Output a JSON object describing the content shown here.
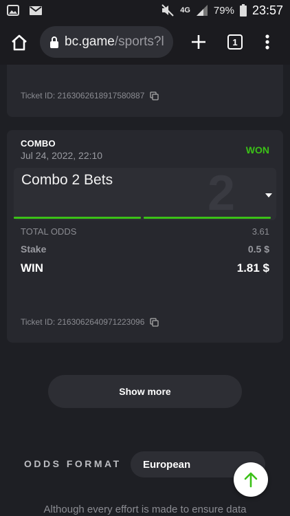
{
  "status_bar": {
    "network": "4G",
    "battery": "79%",
    "time": "23:57",
    "icons": [
      "image-icon",
      "mail-icon",
      "mute-icon",
      "signal-icon",
      "battery-icon"
    ]
  },
  "browser": {
    "url_host": "bc.game",
    "url_path": "/sports?l",
    "tab_count": "1",
    "icons": [
      "home-icon",
      "lock-icon",
      "plus-icon",
      "tabs-icon",
      "more-vert-icon"
    ]
  },
  "previous_ticket": {
    "ticket_id": "Ticket ID: 2163062618917580887"
  },
  "bet": {
    "type": "COMBO",
    "date": "Jul 24, 2022, 22:10",
    "status": "WON",
    "combo_title": "Combo 2 Bets",
    "combo_count": "2",
    "total_odds_label": "TOTAL ODDS",
    "total_odds_value": "3.61",
    "stake_label": "Stake",
    "stake_value": "0.5 $",
    "win_label": "WIN",
    "win_value": "1.81 $",
    "ticket_id": "Ticket ID: 2163062640971223096"
  },
  "show_more_label": "Show more",
  "odds_format": {
    "label": "ODDS FORMAT",
    "value": "European"
  },
  "disclaimer": "Although every effort is made to ensure data",
  "colors": {
    "background": "#1e1f24",
    "card": "#27282e",
    "won_green": "#3bc117"
  }
}
